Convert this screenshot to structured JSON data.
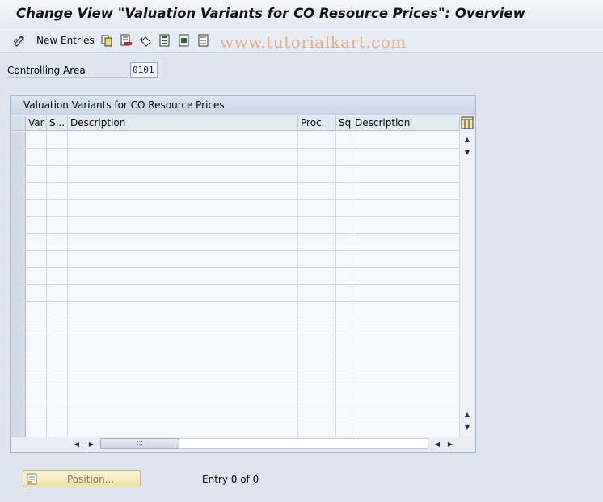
{
  "window": {
    "title": "Change View \"Valuation Variants for CO Resource Prices\": Overview"
  },
  "toolbar": {
    "new_entries_label": "New Entries",
    "icons": [
      "edit-toggle-icon",
      "copy-icon",
      "delete-icon",
      "undo-icon",
      "select-all-icon",
      "select-block-icon",
      "deselect-all-icon"
    ]
  },
  "watermark": "www.tutorialkart.com",
  "controlling_area": {
    "label": "Controlling Area",
    "value": "0101"
  },
  "table": {
    "title": "Valuation Variants for CO Resource Prices",
    "columns": [
      "Var",
      "S...",
      "Description",
      "Proc.",
      "Sq",
      "Description"
    ],
    "row_count": 18
  },
  "footer": {
    "position_label": "Position...",
    "entry_text": "Entry 0 of 0"
  },
  "colors": {
    "background": "#dfe6ef",
    "table_header": "#c7d5e6",
    "position_button": "#efe2a4"
  }
}
